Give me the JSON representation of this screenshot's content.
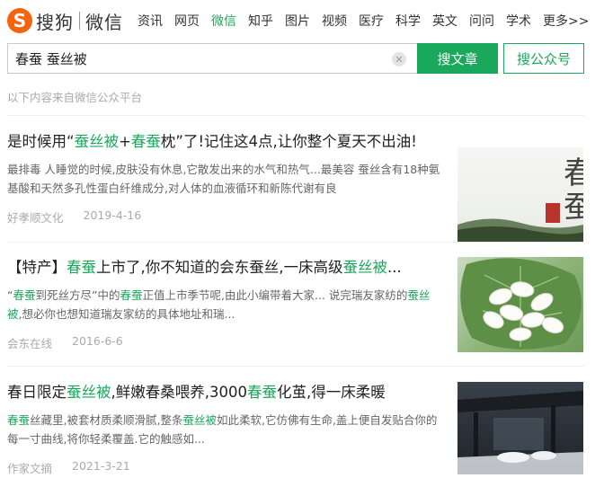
{
  "brand": {
    "logo_mark": "S",
    "name": "搜狗",
    "product": "微信"
  },
  "nav": [
    "资讯",
    "网页",
    "微信",
    "知乎",
    "图片",
    "视频",
    "医疗",
    "科学",
    "英文",
    "问问",
    "学术",
    "更多>>"
  ],
  "nav_active_index": 2,
  "search": {
    "query": "春蚕 蚕丝被",
    "clear_icon": "clear-icon"
  },
  "buttons": {
    "search_article": "搜文章",
    "search_account": "搜公众号"
  },
  "source_note": "以下内容来自微信公众平台",
  "colors": {
    "accent": "#1aa85c",
    "logo": "#f5630a",
    "meta": "#aaaaaa"
  },
  "results": [
    {
      "title_parts": [
        {
          "t": "是时候用“",
          "hl": false
        },
        {
          "t": "蚕丝被",
          "hl": true
        },
        {
          "t": "+",
          "hl": false
        },
        {
          "t": "春蚕",
          "hl": true
        },
        {
          "t": "枕”了!记住这4点,让你整个夏天不出油!",
          "hl": false
        }
      ],
      "desc_parts": [
        {
          "t": "最排毒 人睡觉的时候,皮肤没有休息,它散发出来的水气和热气...最美容 蚕丝含有18种氨基酸和天然多孔性蛋白纤维成分,对人体的血液循环和新陈代谢有良",
          "hl": false
        }
      ],
      "source": "好孝顺文化",
      "date": "2019-4-16",
      "thumb_text": "春蚕",
      "thumb_seal": "精品"
    },
    {
      "title_parts": [
        {
          "t": "【特产】",
          "hl": false
        },
        {
          "t": "春蚕",
          "hl": true
        },
        {
          "t": "上市了,你不知道的会东蚕丝,一床高级",
          "hl": false
        },
        {
          "t": "蚕丝被",
          "hl": true
        },
        {
          "t": "...",
          "hl": false
        }
      ],
      "desc_parts": [
        {
          "t": "“",
          "hl": false
        },
        {
          "t": "春蚕",
          "hl": true
        },
        {
          "t": "到死丝方尽”中的",
          "hl": false
        },
        {
          "t": "春蚕",
          "hl": true
        },
        {
          "t": "正值上市季节呢,由此小编带着大家... 说完瑞友家纺的",
          "hl": false
        },
        {
          "t": "蚕丝被",
          "hl": true
        },
        {
          "t": ",想必你也想知道瑞友家纺的具体地址和瑞...",
          "hl": false
        }
      ],
      "source": "会东在线",
      "date": "2016-6-6"
    },
    {
      "title_parts": [
        {
          "t": "春日限定",
          "hl": false
        },
        {
          "t": "蚕丝被",
          "hl": true
        },
        {
          "t": ",鲜嫩春桑喂养,3000",
          "hl": false
        },
        {
          "t": "春蚕",
          "hl": true
        },
        {
          "t": "化茧,得一床柔暖",
          "hl": false
        }
      ],
      "desc_parts": [
        {
          "t": "春蚕",
          "hl": true
        },
        {
          "t": "丝藏里,被套材质柔顺滑腻,整条",
          "hl": false
        },
        {
          "t": "蚕丝被",
          "hl": true
        },
        {
          "t": "如此柔软,它仿佛有生命,盖上便自发贴合你的每一寸曲线,将你轻柔覆盖.它的触感如...",
          "hl": false
        }
      ],
      "source": "作家文摘",
      "date": "2021-3-21"
    }
  ]
}
